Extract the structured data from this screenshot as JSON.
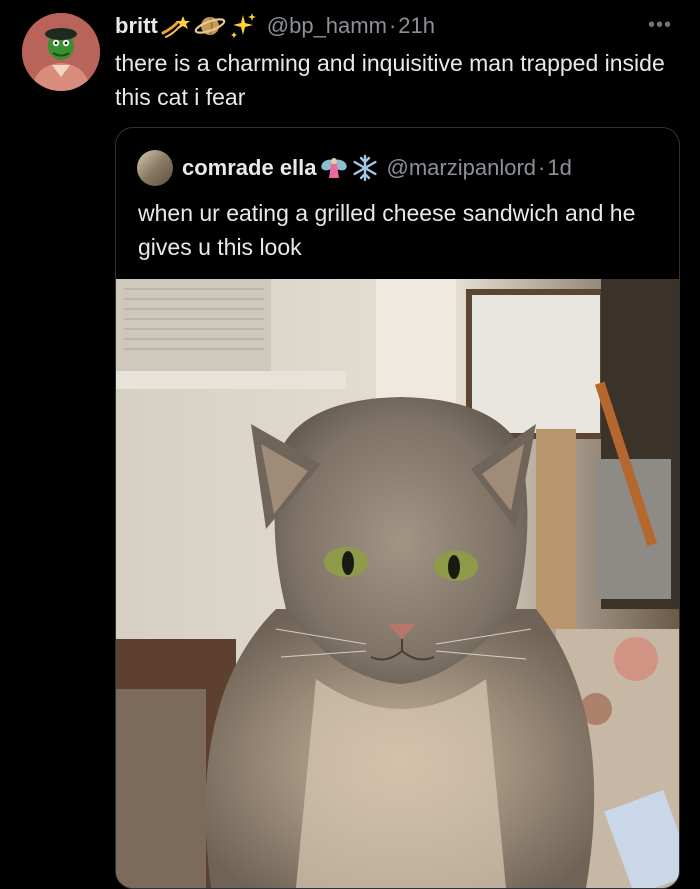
{
  "tweet": {
    "author_name": "britt",
    "name_emojis": [
      "shooting-star-icon",
      "saturn-icon",
      "sparkles-icon"
    ],
    "handle": "@bp_hamm",
    "separator": "·",
    "time": "21h",
    "more_label": "•••",
    "text": "there is a charming and inquisitive man trapped inside this cat i fear"
  },
  "quoted": {
    "author_name": "comrade ella",
    "name_emojis": [
      "fairy-icon",
      "snowflake-icon"
    ],
    "handle": "@marzipanlord",
    "separator": "·",
    "time": "1d",
    "text": "when ur eating a grilled cheese sandwich and he gives u this look",
    "media": "cat-photo"
  },
  "colors": {
    "background": "#000000",
    "text": "#e7e9ea",
    "secondary_text": "#8b9197",
    "border": "#2f3336"
  }
}
